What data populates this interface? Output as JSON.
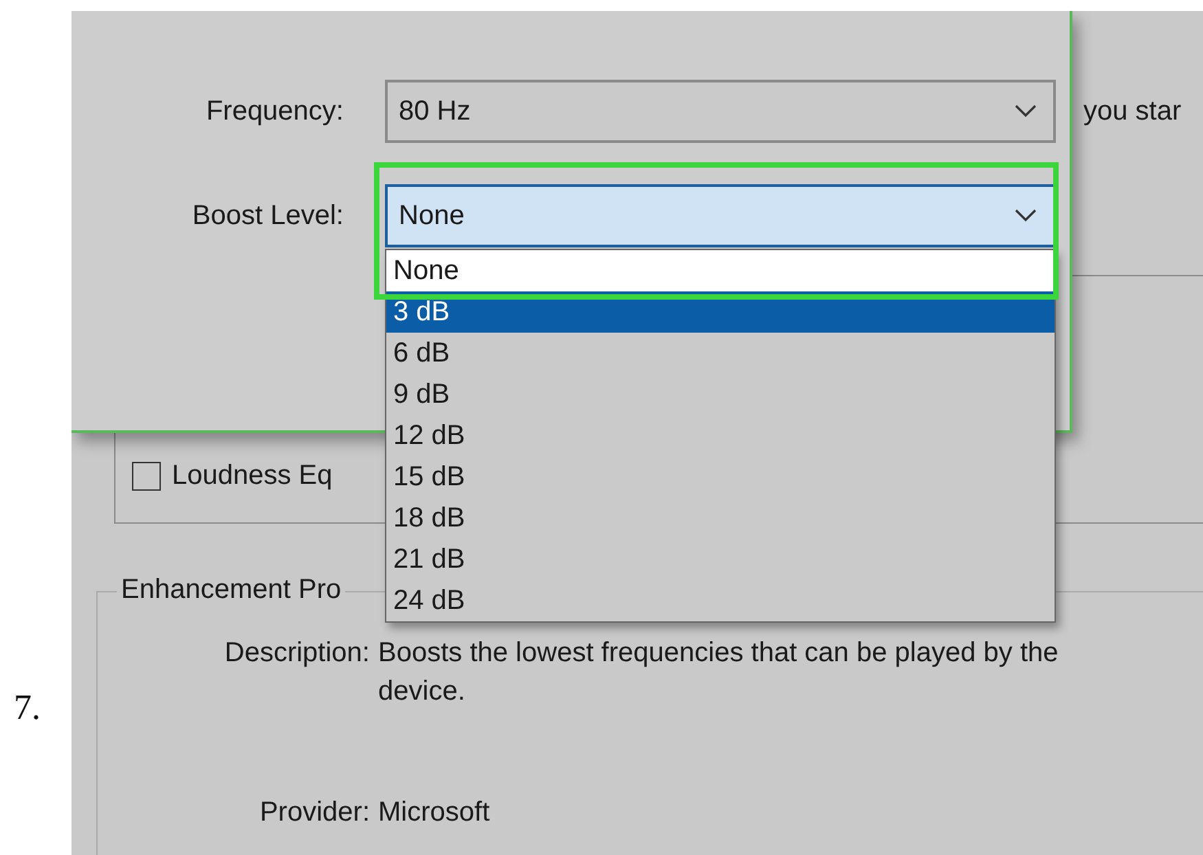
{
  "step_number": "7.",
  "dialog": {
    "fields": [
      {
        "label": "Frequency:",
        "value": "80 Hz",
        "annotated": false
      },
      {
        "label": "Boost Level:",
        "value": "None",
        "annotated": true
      }
    ],
    "dropdown": {
      "options": [
        {
          "label": "None",
          "selected": false,
          "annotated": true
        },
        {
          "label": "3 dB",
          "selected": true,
          "annotated": false
        },
        {
          "label": "6 dB",
          "selected": false,
          "annotated": false
        },
        {
          "label": "9 dB",
          "selected": false,
          "annotated": false
        },
        {
          "label": "12 dB",
          "selected": false,
          "annotated": false
        },
        {
          "label": "15 dB",
          "selected": false,
          "annotated": false
        },
        {
          "label": "18 dB",
          "selected": false,
          "annotated": false
        },
        {
          "label": "21 dB",
          "selected": false,
          "annotated": false
        },
        {
          "label": "24 dB",
          "selected": false,
          "annotated": false
        }
      ]
    }
  },
  "background": {
    "cut_text": "you star",
    "checkboxes": [
      {
        "label": "Loudness Eq",
        "checked": false
      }
    ],
    "enhancement_group": {
      "title": "Enhancement Pro",
      "description_label": "Description:",
      "description": "Boosts the lowest frequencies that can be played by the device.",
      "provider_label": "Provider:",
      "provider": "Microsoft"
    }
  }
}
